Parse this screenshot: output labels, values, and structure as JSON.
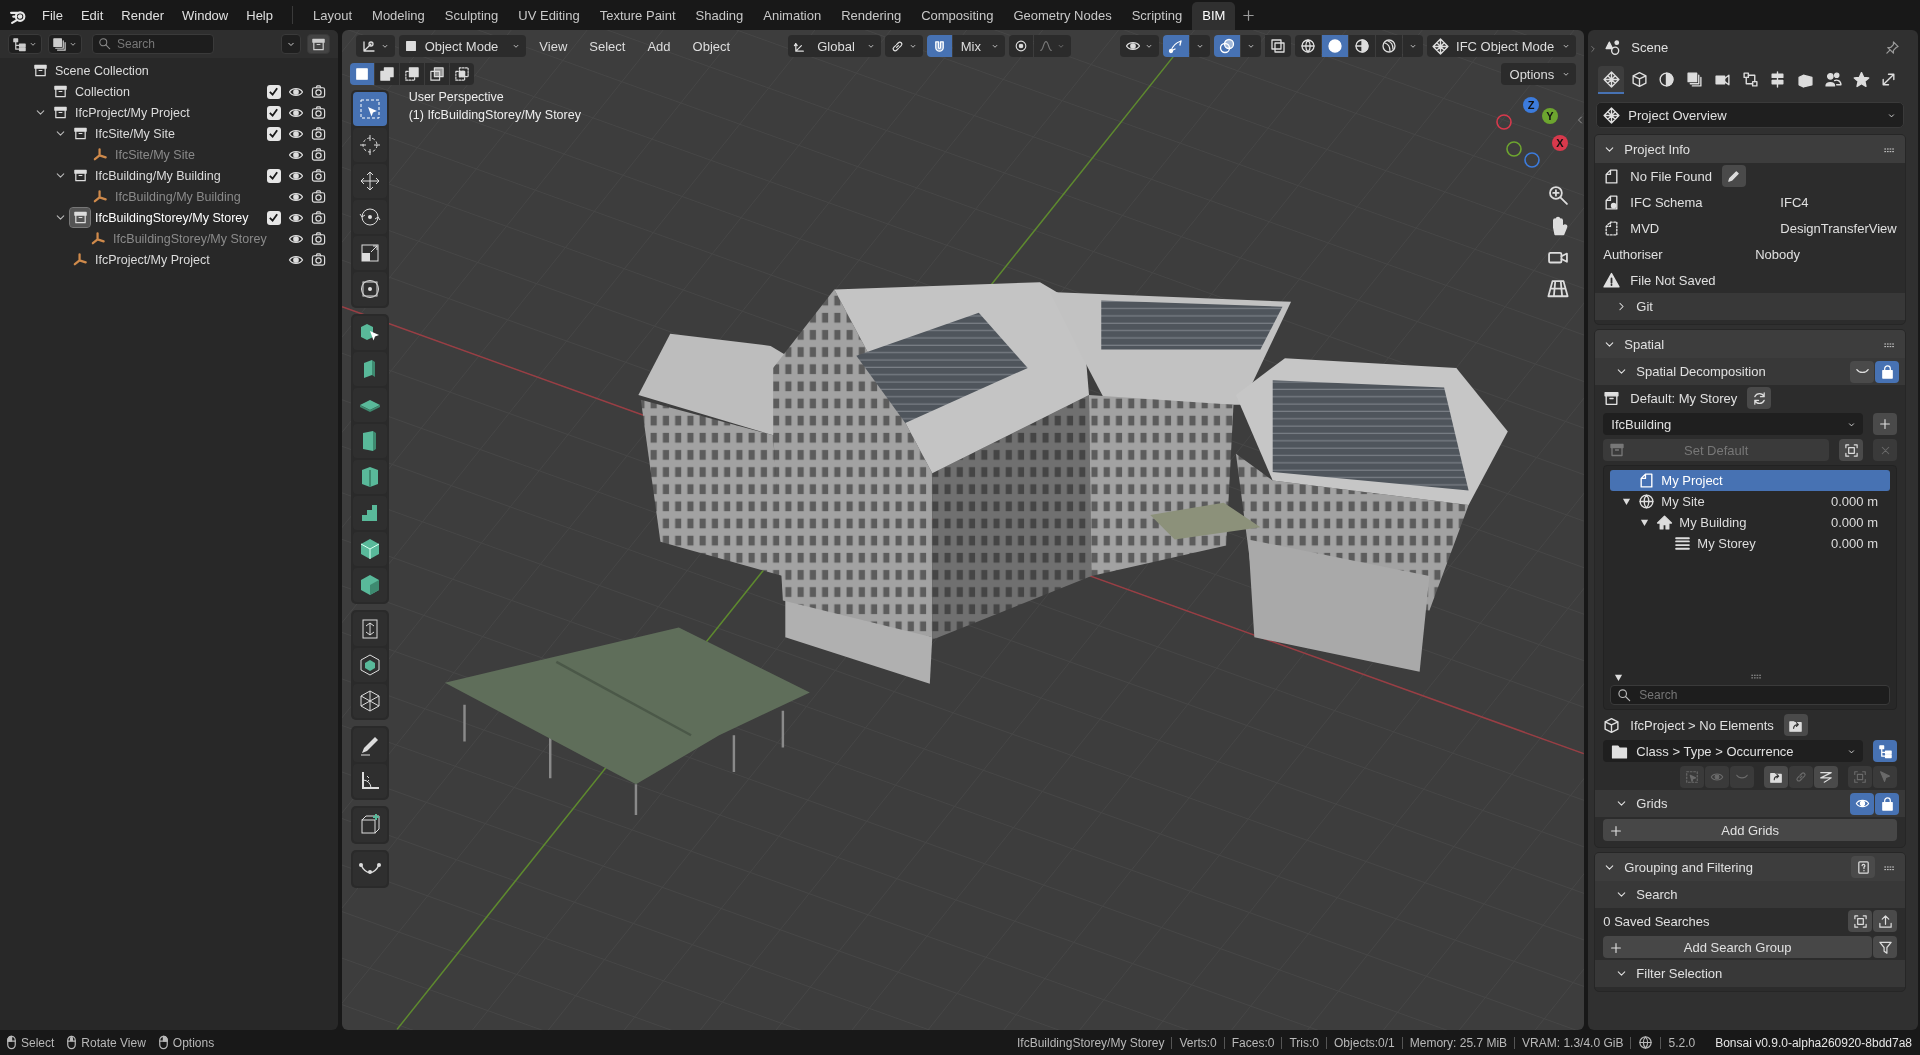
{
  "menu": [
    "File",
    "Edit",
    "Render",
    "Window",
    "Help"
  ],
  "workspaces": [
    {
      "label": "Layout",
      "selected": false
    },
    {
      "label": "Modeling",
      "selected": false
    },
    {
      "label": "Sculpting",
      "selected": false
    },
    {
      "label": "UV Editing",
      "selected": false
    },
    {
      "label": "Texture Paint",
      "selected": false
    },
    {
      "label": "Shading",
      "selected": false
    },
    {
      "label": "Animation",
      "selected": false
    },
    {
      "label": "Rendering",
      "selected": false
    },
    {
      "label": "Compositing",
      "selected": false
    },
    {
      "label": "Geometry Nodes",
      "selected": false
    },
    {
      "label": "Scripting",
      "selected": false
    },
    {
      "label": "BIM",
      "selected": true
    }
  ],
  "outliner": {
    "search_placeholder": "Search",
    "tree": [
      {
        "label": "Scene Collection",
        "kind": "scene",
        "selected": false,
        "dimmed": false,
        "children": [
          {
            "label": "Collection",
            "kind": "collection",
            "checked": true,
            "selected": false,
            "dimmed": false
          },
          {
            "label": "IfcProject/My Project",
            "kind": "collection",
            "checked": true,
            "expanded": true,
            "selected": false,
            "dimmed": false,
            "children": [
              {
                "label": "IfcSite/My Site",
                "kind": "collection",
                "checked": true,
                "expanded": true,
                "selected": false,
                "dimmed": false,
                "children": [
                  {
                    "label": "IfcSite/My Site",
                    "kind": "empty",
                    "selected": false,
                    "dimmed": true
                  }
                ]
              },
              {
                "label": "IfcBuilding/My Building",
                "kind": "collection",
                "checked": true,
                "expanded": true,
                "selected": false,
                "dimmed": false,
                "children": [
                  {
                    "label": "IfcBuilding/My Building",
                    "kind": "empty",
                    "selected": false,
                    "dimmed": true
                  }
                ]
              },
              {
                "label": "IfcBuildingStorey/My Storey",
                "kind": "collection",
                "checked": true,
                "expanded": true,
                "selected": true,
                "dimmed": false,
                "children": [
                  {
                    "label": "IfcBuildingStorey/My Storey",
                    "kind": "empty",
                    "selected": false,
                    "dimmed": true
                  }
                ]
              },
              {
                "label": "IfcProject/My Project",
                "kind": "empty",
                "selected": false,
                "dimmed": false
              }
            ]
          }
        ]
      }
    ]
  },
  "viewport": {
    "mode": "Object Mode",
    "menus": [
      "View",
      "Select",
      "Add",
      "Object"
    ],
    "orientation": "Global",
    "snap": {
      "on": true,
      "target": "Mix"
    },
    "proportional": {
      "on": false
    },
    "toggles": [
      {
        "kind": "gizmo",
        "on": true
      },
      {
        "kind": "overlays",
        "on": true
      },
      {
        "kind": "xray",
        "on": false
      }
    ],
    "shading": [
      {
        "kind": "wireframe",
        "selected": false
      },
      {
        "kind": "solid",
        "selected": true
      },
      {
        "kind": "material",
        "selected": false
      },
      {
        "kind": "rendered",
        "selected": false
      }
    ],
    "ifc_mode": "IFC Object Mode",
    "select_modes": [
      {
        "kind": "set",
        "selected": true
      },
      {
        "kind": "extend",
        "selected": false
      },
      {
        "kind": "subtract",
        "selected": false
      },
      {
        "kind": "invert",
        "selected": false
      },
      {
        "kind": "intersect",
        "selected": false
      }
    ],
    "options": "Options",
    "overlay_text": [
      "User Perspective",
      "(1) IfcBuildingStorey/My Storey"
    ],
    "tool_groups": [
      {
        "tools": [
          {
            "kind": "select-box",
            "selected": true
          },
          {
            "kind": "cursor",
            "selected": false
          },
          {
            "kind": "move",
            "selected": false
          },
          {
            "kind": "rotate",
            "selected": false
          },
          {
            "kind": "scale",
            "selected": false
          },
          {
            "kind": "transform",
            "selected": false
          }
        ]
      },
      {
        "tools": [
          {
            "kind": "pointer-block",
            "selected": false
          },
          {
            "kind": "wall",
            "selected": false
          },
          {
            "kind": "slab",
            "selected": false
          },
          {
            "kind": "door",
            "selected": false
          },
          {
            "kind": "column",
            "selected": false
          },
          {
            "kind": "stair",
            "selected": false
          },
          {
            "kind": "box",
            "selected": false
          },
          {
            "kind": "cube",
            "selected": false
          }
        ]
      },
      {
        "tools": [
          {
            "kind": "opening",
            "selected": false
          },
          {
            "kind": "space",
            "selected": false
          },
          {
            "kind": "grid",
            "selected": false
          }
        ]
      },
      {
        "tools": [
          {
            "kind": "annotate",
            "selected": false
          },
          {
            "kind": "measure",
            "selected": false
          }
        ]
      },
      {
        "tools": [
          {
            "kind": "add-cube",
            "selected": false
          }
        ]
      },
      {
        "tools": [
          {
            "kind": "curve",
            "selected": false
          }
        ]
      }
    ],
    "axes": [
      {
        "label": "Z",
        "color": "#3c7bdc"
      },
      {
        "label": "Y",
        "color": "#6da52f"
      },
      {
        "label": "X",
        "color": "#d8394c"
      }
    ]
  },
  "properties": {
    "context": "Scene",
    "tabs": [
      {
        "kind": "overview",
        "selected": true
      },
      {
        "kind": "object",
        "selected": false
      },
      {
        "kind": "material",
        "selected": false
      },
      {
        "kind": "layers",
        "selected": false
      },
      {
        "kind": "drawing",
        "selected": false
      },
      {
        "kind": "structure",
        "selected": false
      },
      {
        "kind": "services",
        "selected": false
      },
      {
        "kind": "assets",
        "selected": false
      },
      {
        "kind": "people",
        "selected": false
      },
      {
        "kind": "favorite",
        "selected": false
      },
      {
        "kind": "transfer",
        "selected": false
      }
    ],
    "page": "Project Overview",
    "panels": [
      {
        "title": "Project Info",
        "expanded": true,
        "rows": [
          {
            "kind": "file",
            "label": "No File Found"
          },
          {
            "kind": "schema",
            "label": "IFC Schema",
            "value": "IFC4"
          },
          {
            "kind": "mvd",
            "label": "MVD",
            "value": "DesignTransferView"
          },
          {
            "kind": "plain",
            "label": "Authoriser",
            "value": "Nobody"
          },
          {
            "kind": "warning",
            "label": "File Not Saved"
          },
          {
            "kind": "subpanel",
            "title": "Git",
            "expanded": false
          }
        ]
      },
      {
        "title": "Spatial",
        "expanded": true,
        "rows": [
          {
            "kind": "subpanel",
            "title": "Spatial Decomposition",
            "expanded": true,
            "locked": true
          },
          {
            "kind": "default",
            "label": "Default: My Storey"
          },
          {
            "kind": "dropdown",
            "value": "IfcBuilding"
          },
          {
            "kind": "disabled-button",
            "label": "Set Default"
          },
          {
            "kind": "tree",
            "search_placeholder": "Search",
            "items": [
              {
                "label": "My Project",
                "kind": "project",
                "selected": true,
                "children": [
                  {
                    "label": "My Site",
                    "kind": "site",
                    "elevation": "0.000 m",
                    "expanded": true,
                    "selected": false,
                    "children": [
                      {
                        "label": "My Building",
                        "kind": "building",
                        "elevation": "0.000 m",
                        "expanded": true,
                        "selected": false,
                        "children": [
                          {
                            "label": "My Storey",
                            "kind": "storey",
                            "elevation": "0.000 m",
                            "selected": false
                          }
                        ]
                      }
                    ]
                  }
                ]
              }
            ]
          },
          {
            "kind": "elements",
            "label": "IfcProject > No Elements"
          },
          {
            "kind": "grouping",
            "value": "Class > Type > Occurrence"
          },
          {
            "kind": "toolstrip"
          },
          {
            "kind": "subpanel",
            "title": "Grids",
            "expanded": true,
            "visible": true,
            "locked": true
          },
          {
            "kind": "add-button",
            "label": "Add Grids"
          }
        ]
      },
      {
        "title": "Grouping and Filtering",
        "expanded": true,
        "rows": [
          {
            "kind": "subpanel",
            "title": "Search",
            "expanded": true
          },
          {
            "kind": "saved",
            "label": "0 Saved Searches"
          },
          {
            "kind": "add-group",
            "label": "Add Search Group"
          },
          {
            "kind": "subpanel",
            "title": "Filter Selection",
            "expanded": true
          }
        ]
      }
    ]
  },
  "status": {
    "hints": [
      {
        "kind": "left",
        "label": "Select"
      },
      {
        "kind": "middle",
        "label": "Rotate View"
      },
      {
        "kind": "right",
        "label": "Options"
      }
    ],
    "stats": [
      "IfcBuildingStorey/My Storey",
      "Verts:0",
      "Faces:0",
      "Tris:0",
      "Objects:0/1",
      "Memory: 25.7 MiB",
      "VRAM: 1.3/4.0 GiB"
    ],
    "version": "5.2.0",
    "addon": "Bonsai v0.9.0-alpha260920-8bdd7a8"
  }
}
